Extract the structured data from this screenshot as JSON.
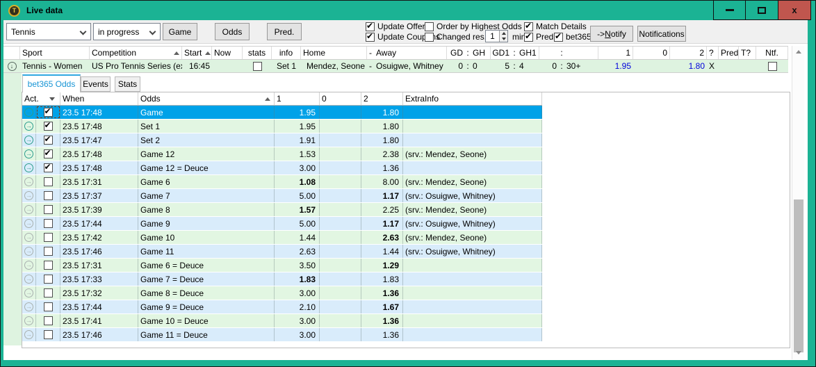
{
  "window": {
    "title": "Live data",
    "icon_letter": "T",
    "close_glyph": "x"
  },
  "toolbar": {
    "sport_filter": "Tennis",
    "status_filter": "in progress",
    "game_button": "Game",
    "odds_button": "Odds",
    "pred_button": "Pred.",
    "update_offer": {
      "label": "Update Offer",
      "checked": true
    },
    "update_coupons": {
      "label": "Update Coupons",
      "checked": true
    },
    "order_by_highest_odds": {
      "label": "Order by Highest Odds",
      "checked": false
    },
    "changed_res": {
      "label": "Changed res.",
      "checked": false
    },
    "interval": {
      "value": "1",
      "unit": "min."
    },
    "match_details": {
      "label": "Match Details",
      "checked": true
    },
    "pred_option": {
      "label": "Pred.",
      "checked": true
    },
    "bet365_option": {
      "label": "bet365",
      "checked": true
    },
    "notify_button": {
      "prefix": "-> ",
      "accel": "N",
      "rest": "otify"
    },
    "notifications_button": "Notifications"
  },
  "match_list": {
    "headers": {
      "sport": "Sport",
      "competition": "Competition",
      "start": "Start",
      "now": "Now",
      "stats": "stats",
      "info": "info",
      "home": "Home",
      "dash": "-",
      "away": "Away",
      "gd": "GD",
      "gh": "GH",
      "gd1": "GD1",
      "gh1": "GH1",
      "colon": ":",
      "c1": "1",
      "c0": "0",
      "c2": "2",
      "q": "?",
      "pred": "Pred",
      "tq": "T?",
      "ntf": "Ntf."
    },
    "match": {
      "sport": "Tennis - Women",
      "competition": "US Pro Tennis Series (exh.)",
      "start": "16:45",
      "now": "",
      "stats_checked": false,
      "info": "Set 1",
      "home": "Mendez, Seone",
      "dash": "-",
      "away": "Osuigwe, Whitney",
      "colon": ":",
      "gd": "0",
      "gh": "0",
      "gd1": "5",
      "gh1": "4",
      "g3a": "0",
      "g3b": "30+",
      "odds1": "1.95",
      "odds0": "",
      "odds2": "1.80",
      "pick": "X",
      "pred": "",
      "tq": "",
      "ntf_checked": false
    }
  },
  "tabs": {
    "bet365_odds": "bet365 Odds",
    "events": "Events",
    "stats": "Stats"
  },
  "odds_table": {
    "headers": {
      "act": "Act.",
      "when": "When",
      "odds": "Odds",
      "c1": "1",
      "c0": "0",
      "c2": "2",
      "extra": "ExtraInfo"
    },
    "rows": [
      {
        "selected": true,
        "checked": true,
        "when": "23.5 17:48",
        "odds": "Game",
        "v1": "1.95",
        "v0": "",
        "v2": "1.80",
        "extra": "",
        "b1": false,
        "b2": false
      },
      {
        "checked": true,
        "when": "23.5 17:48",
        "odds": "Set 1",
        "v1": "1.95",
        "v0": "",
        "v2": "1.80",
        "extra": "",
        "b1": false,
        "b2": false
      },
      {
        "checked": true,
        "when": "23.5 17:47",
        "odds": "Set 2",
        "v1": "1.91",
        "v0": "",
        "v2": "1.80",
        "extra": "",
        "b1": false,
        "b2": false
      },
      {
        "checked": true,
        "when": "23.5 17:48",
        "odds": "Game 12",
        "v1": "1.53",
        "v0": "",
        "v2": "2.38",
        "extra": "(srv.: Mendez, Seone)",
        "b1": false,
        "b2": false
      },
      {
        "checked": true,
        "when": "23.5 17:48",
        "odds": "Game 12 = Deuce",
        "v1": "3.00",
        "v0": "",
        "v2": "1.36",
        "extra": "",
        "b1": false,
        "b2": false
      },
      {
        "checked": false,
        "when": "23.5 17:31",
        "odds": "Game 6",
        "v1": "1.08",
        "v0": "",
        "v2": "8.00",
        "extra": "(srv.: Mendez, Seone)",
        "b1": true,
        "b2": false
      },
      {
        "checked": false,
        "when": "23.5 17:37",
        "odds": "Game 7",
        "v1": "5.00",
        "v0": "",
        "v2": "1.17",
        "extra": "(srv.: Osuigwe, Whitney)",
        "b1": false,
        "b2": true
      },
      {
        "checked": false,
        "when": "23.5 17:39",
        "odds": "Game 8",
        "v1": "1.57",
        "v0": "",
        "v2": "2.25",
        "extra": "(srv.: Mendez, Seone)",
        "b1": true,
        "b2": false
      },
      {
        "checked": false,
        "when": "23.5 17:44",
        "odds": "Game 9",
        "v1": "5.00",
        "v0": "",
        "v2": "1.17",
        "extra": "(srv.: Osuigwe, Whitney)",
        "b1": false,
        "b2": true
      },
      {
        "checked": false,
        "when": "23.5 17:42",
        "odds": "Game 10",
        "v1": "1.44",
        "v0": "",
        "v2": "2.63",
        "extra": "(srv.: Mendez, Seone)",
        "b1": false,
        "b2": true
      },
      {
        "checked": false,
        "when": "23.5 17:46",
        "odds": "Game 11",
        "v1": "2.63",
        "v0": "",
        "v2": "1.44",
        "extra": "(srv.: Osuigwe, Whitney)",
        "b1": false,
        "b2": false
      },
      {
        "checked": false,
        "when": "23.5 17:31",
        "odds": "Game 6 = Deuce",
        "v1": "3.50",
        "v0": "",
        "v2": "1.29",
        "extra": "",
        "b1": false,
        "b2": true
      },
      {
        "checked": false,
        "when": "23.5 17:33",
        "odds": "Game 7 = Deuce",
        "v1": "1.83",
        "v0": "",
        "v2": "1.83",
        "extra": "",
        "b1": true,
        "b2": false
      },
      {
        "checked": false,
        "when": "23.5 17:32",
        "odds": "Game 8 = Deuce",
        "v1": "3.00",
        "v0": "",
        "v2": "1.36",
        "extra": "",
        "b1": false,
        "b2": true
      },
      {
        "checked": false,
        "when": "23.5 17:44",
        "odds": "Game 9 = Deuce",
        "v1": "2.10",
        "v0": "",
        "v2": "1.67",
        "extra": "",
        "b1": false,
        "b2": true
      },
      {
        "checked": false,
        "when": "23.5 17:41",
        "odds": "Game 10 = Deuce",
        "v1": "3.00",
        "v0": "",
        "v2": "1.36",
        "extra": "",
        "b1": false,
        "b2": true
      },
      {
        "checked": false,
        "when": "23.5 17:46",
        "odds": "Game 11 = Deuce",
        "v1": "3.00",
        "v0": "",
        "v2": "1.36",
        "extra": "",
        "b1": false,
        "b2": false
      }
    ]
  }
}
